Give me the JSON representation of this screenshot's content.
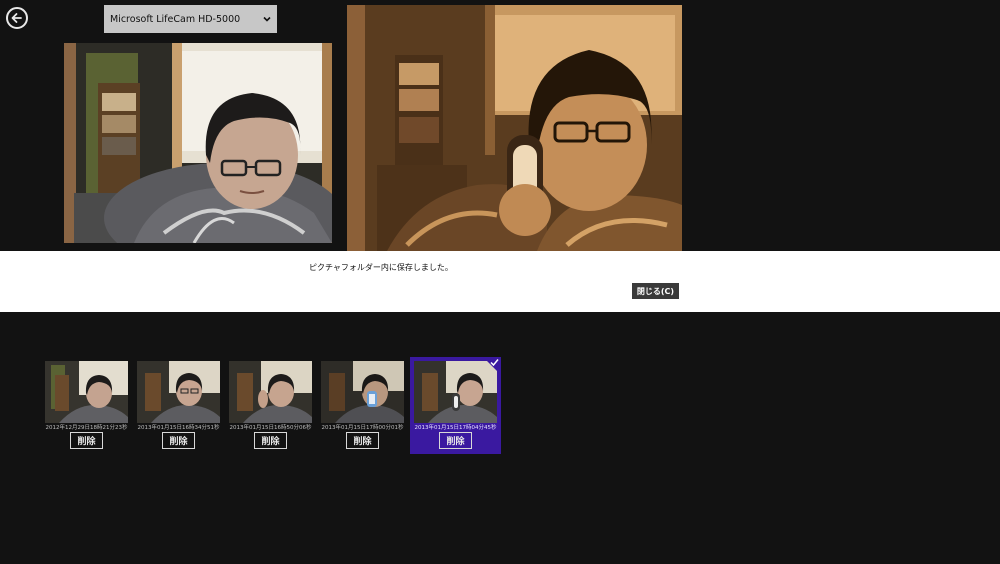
{
  "camera_select": {
    "value": "Microsoft LifeCam HD-5000",
    "icon": "chevron-down-icon"
  },
  "back_button": {
    "icon": "back-arrow-icon"
  },
  "notification": {
    "message": "ピクチャフォルダー内に保存しました。",
    "close_label": "閉じる(C)"
  },
  "thumbnails": [
    {
      "timestamp": "2012年12月29日18時21分23秒",
      "delete_label": "削除",
      "selected": false
    },
    {
      "timestamp": "2013年01月15日16時34分51秒",
      "delete_label": "削除",
      "selected": false
    },
    {
      "timestamp": "2013年01月15日16時50分06秒",
      "delete_label": "削除",
      "selected": false
    },
    {
      "timestamp": "2013年01月15日17時00分01秒",
      "delete_label": "削除",
      "selected": false
    },
    {
      "timestamp": "2013年01月15日17時04分45秒",
      "delete_label": "削除",
      "selected": true
    }
  ],
  "colors": {
    "background": "#121212",
    "selection": "#3a19a0",
    "sepia": "#b07a45",
    "notify_bg": "#ffffff"
  }
}
